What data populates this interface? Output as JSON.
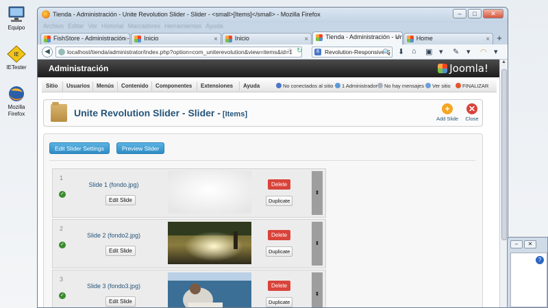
{
  "desktop": {
    "icons": [
      {
        "label": "Equipo"
      },
      {
        "label": "IETester"
      },
      {
        "label": "Mozilla Firefox"
      }
    ]
  },
  "window": {
    "title": "Tienda - Administración - Unite Revolution Slider - Slider - <small>[Items]</small> - Mozilla Firefox",
    "menu_items": [
      "Archivo",
      "Editar",
      "Ver",
      "Historial",
      "Marcadores",
      "Herramientas",
      "Ayuda"
    ],
    "tabs": [
      {
        "label": "FishStore - Administración - U...",
        "active": false
      },
      {
        "label": "Inicio",
        "active": false
      },
      {
        "label": "Inicio",
        "active": false
      },
      {
        "label": "Tienda - Administración - Unit...",
        "active": true
      },
      {
        "label": "Home",
        "active": false
      }
    ],
    "new_tab": "+",
    "url": "localhost/tienda/administrator/index.php?option=com_uniterevolution&view=items&id=1",
    "search_engine": "8",
    "search_text": "Revolution-Responsive-S"
  },
  "joomla": {
    "header_title": "Administración",
    "logo_text": "Joomla!",
    "menu": [
      "Sitio",
      "Usuarios",
      "Menús",
      "Contenido",
      "Componentes",
      "Extensiones",
      "Ayuda"
    ],
    "status": {
      "not_connected": "No conectados al sitio",
      "admins": "1 Administrador",
      "messages": "No hay mensajes",
      "view_site": "Ver sitio",
      "logout": "FINALIZAR"
    },
    "page_title": "Unite Revolution Slider - Slider -",
    "page_title_suffix": "[Items]",
    "toolbar": {
      "add_slide": "Add Slide",
      "close": "Close"
    },
    "buttons": {
      "edit_settings": "Edit Slider Settings",
      "preview": "Preview Slider"
    },
    "slides": [
      {
        "number": "1",
        "title": "Slide 1 (fondo.jpg)",
        "edit": "Edit Slide",
        "delete": "Delete",
        "duplicate": "Duplicate"
      },
      {
        "number": "2",
        "title": "Slide 2 (fondo2.jpg)",
        "edit": "Edit Slide",
        "delete": "Delete",
        "duplicate": "Duplicate"
      },
      {
        "number": "3",
        "title": "Slide 3 (fondo3.jpg)",
        "edit": "Edit Slide",
        "delete": "Delete",
        "duplicate": "Duplicate"
      }
    ]
  },
  "colors": {
    "joomla_blue_text": "#245378",
    "delete_red": "#d9433a",
    "button_blue": "#2e8dc5",
    "header_dark": "#1d1d1d"
  }
}
